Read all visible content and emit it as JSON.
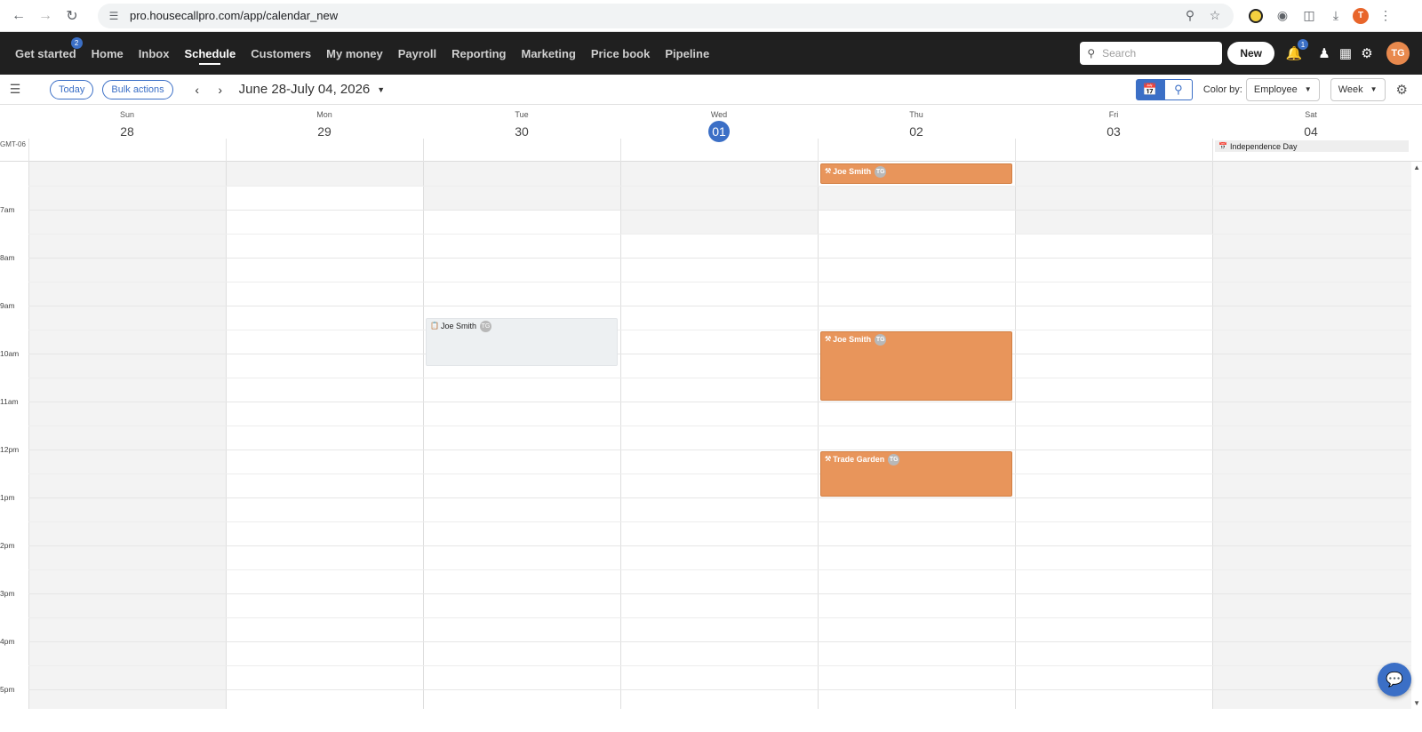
{
  "browser": {
    "url": "pro.housecallpro.com/app/calendar_new",
    "icons": [
      "back-icon",
      "forward-icon",
      "reload-icon",
      "site-settings-icon",
      "zoom-icon",
      "bookmark-star-icon",
      "extension-icon",
      "camera-icon",
      "puzzle-icon",
      "download-icon",
      "profile-avatar",
      "more-icon"
    ],
    "profile_initial": "T"
  },
  "nav": {
    "items": [
      {
        "label": "Get started",
        "badge": "2"
      },
      {
        "label": "Home"
      },
      {
        "label": "Inbox"
      },
      {
        "label": "Schedule",
        "active": true
      },
      {
        "label": "Customers"
      },
      {
        "label": "My money"
      },
      {
        "label": "Payroll"
      },
      {
        "label": "Reporting"
      },
      {
        "label": "Marketing"
      },
      {
        "label": "Price book"
      },
      {
        "label": "Pipeline"
      }
    ],
    "search_placeholder": "Search",
    "new_label": "New",
    "notification_badge": "1",
    "avatar_initials": "TG"
  },
  "toolbar": {
    "today_label": "Today",
    "bulk_label": "Bulk actions",
    "range_title": "June 28-July 04, 2026",
    "color_by_label": "Color by:",
    "color_by_value": "Employee",
    "view_value": "Week"
  },
  "calendar": {
    "timezone": "GMT-06",
    "days": [
      {
        "dow": "Sun",
        "num": "28"
      },
      {
        "dow": "Mon",
        "num": "29"
      },
      {
        "dow": "Tue",
        "num": "30"
      },
      {
        "dow": "Wed",
        "num": "01",
        "today": true
      },
      {
        "dow": "Thu",
        "num": "02"
      },
      {
        "dow": "Fri",
        "num": "03"
      },
      {
        "dow": "Sat",
        "num": "04"
      }
    ],
    "allday_event": "Independence Day",
    "time_labels": [
      "7am",
      "8am",
      "9am",
      "10am",
      "11am",
      "12pm",
      "1pm",
      "2pm",
      "3pm",
      "4pm",
      "5pm"
    ],
    "events": [
      {
        "name": "Joe Smith",
        "initials": "TG",
        "day": "Thu",
        "color": "#e8955b"
      },
      {
        "name": "Joe Smith",
        "initials": "TG",
        "day": "Tue",
        "color": "#edf0f2"
      },
      {
        "name": "Joe Smith",
        "initials": "TG",
        "day": "Thu",
        "color": "#e8955b"
      },
      {
        "name": "Trade Garden",
        "initials": "TG",
        "day": "Thu",
        "color": "#e8955b"
      }
    ]
  },
  "colors": {
    "accent": "#3b6fc6",
    "header_bg": "#202020",
    "event_orange": "#e8955b"
  }
}
